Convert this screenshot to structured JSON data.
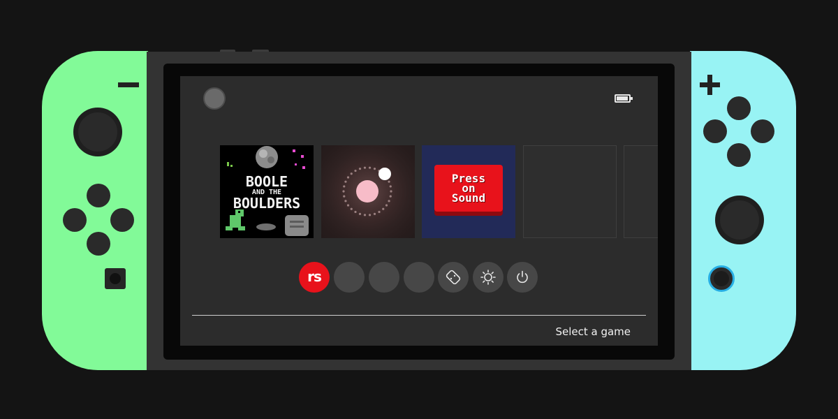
{
  "screen": {
    "footer_label": "Select a game",
    "battery_level": 0.85
  },
  "games": [
    {
      "title_line1": "BOOLE",
      "title_line2": "AND THE",
      "title_line3": "BOULDERS"
    },
    {},
    {
      "label": "Press\non\nSound"
    },
    {},
    {}
  ],
  "nav_buttons": [
    {
      "icon": "rs-logo",
      "label": "rs"
    },
    {
      "icon": "blank"
    },
    {
      "icon": "blank"
    },
    {
      "icon": "blank"
    },
    {
      "icon": "controller-icon"
    },
    {
      "icon": "settings-sun-icon"
    },
    {
      "icon": "power-icon"
    }
  ],
  "colors": {
    "joycon_left": "#82fa98",
    "joycon_right": "#98f3f4",
    "accent_red": "#e8121b",
    "home_ring": "#27aee4"
  }
}
